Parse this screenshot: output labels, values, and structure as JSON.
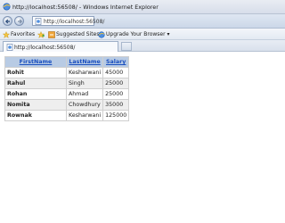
{
  "window": {
    "title": "http://localhost:56508/ - Windows Internet Explorer"
  },
  "address_bar": {
    "url": "http://localhost:56508/"
  },
  "favorites_bar": {
    "favorites_label": "Favorites",
    "suggested_sites_label": "Suggested Sites ▾",
    "upgrade_label": "Upgrade Your Browser ▾"
  },
  "tab": {
    "label": "http://localhost:56508/"
  },
  "table": {
    "headers": [
      "FirstName",
      "LastName",
      "Salary"
    ],
    "rows": [
      [
        "Rohit",
        "Kesharwani",
        "45000"
      ],
      [
        "Rahul",
        "Singh",
        "25000"
      ],
      [
        "Rohan",
        "Ahmad",
        "25000"
      ],
      [
        "Nomita",
        "Chowdhury",
        "35000"
      ],
      [
        "Rownak",
        "Kesharwani",
        "125000"
      ]
    ]
  }
}
